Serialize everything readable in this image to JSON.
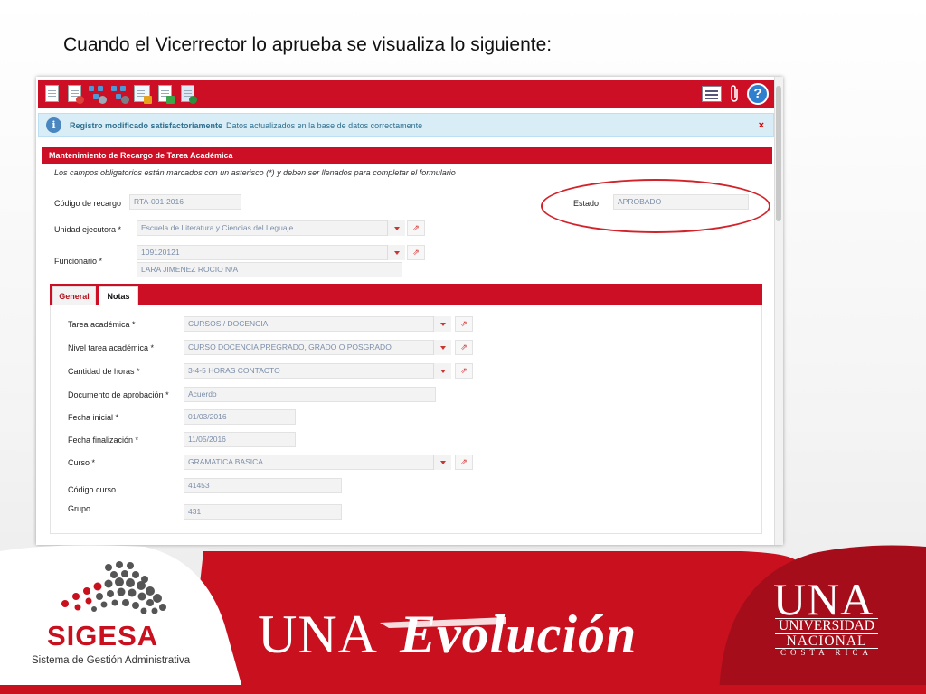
{
  "slide": {
    "title": "Cuando el Vicerrector lo aprueba se visualiza lo siguiente:"
  },
  "toolbar": {
    "left_icons": [
      "new-document-icon",
      "delete-document-icon",
      "workflow-search-icon",
      "workflow-settings-icon",
      "form-edit-icon",
      "document-return-icon",
      "user-add-icon"
    ],
    "right_icons": [
      "list-view-icon",
      "attachment-icon",
      "help-icon"
    ],
    "help_glyph": "?"
  },
  "alert": {
    "icon_glyph": "i",
    "title": "Registro modificado satisfactoriamente",
    "message": "Datos actualizados en la base de datos correctamente",
    "close_glyph": "×"
  },
  "form": {
    "panel_title": "Mantenimiento de Recargo de Tarea Académica",
    "required_note": "Los campos obligatorios están marcados con un asterisco (*) y deben ser llenados para completar el formulario",
    "codigo_recargo": {
      "label": "Código de recargo",
      "value": "RTA-001-2016"
    },
    "estado": {
      "label": "Estado",
      "value": "APROBADO"
    },
    "unidad_ejecutora": {
      "label": "Unidad ejecutora *",
      "value": "Escuela de Literatura y Ciencias del Leguaje"
    },
    "funcionario": {
      "label": "Funcionario *",
      "id_value": "109120121",
      "name_value": "LARA JIMENEZ ROCIO N/A"
    }
  },
  "tabs": [
    {
      "label": "General"
    },
    {
      "label": "Notas"
    }
  ],
  "tab_general": {
    "tarea_academica": {
      "label": "Tarea académica *",
      "value": "CURSOS / DOCENCIA"
    },
    "nivel_tarea": {
      "label": "Nivel tarea académica *",
      "value": "CURSO DOCENCIA PREGRADO, GRADO O POSGRADO"
    },
    "cantidad_horas": {
      "label": "Cantidad de horas *",
      "value": "3-4-5 HORAS CONTACTO"
    },
    "documento_aprobacion": {
      "label": "Documento de aprobación *",
      "value": "Acuerdo"
    },
    "fecha_inicial": {
      "label": "Fecha inicial *",
      "value": "01/03/2016"
    },
    "fecha_finalizacion": {
      "label": "Fecha finalización *",
      "value": "11/05/2016"
    },
    "curso": {
      "label": "Curso *",
      "value": "GRAMATICA BASICA"
    },
    "codigo_curso": {
      "label": "Código curso",
      "value": "41453"
    },
    "grupo": {
      "label": "Grupo",
      "value": "431"
    }
  },
  "link_glyph": "⇗",
  "branding": {
    "sigesa_name": "SIGESA",
    "sigesa_subtitle": "Sistema de Gestión Administrativa",
    "banner_una": "UNA",
    "banner_evolucion": "Evolución",
    "una_logo": "UNA",
    "una_line1": "UNIVERSIDAD",
    "una_line2": "NACIONAL",
    "una_line3": "COSTA RICA"
  },
  "colors": {
    "brand_red": "#cc0f24",
    "dark_red": "#b3151f",
    "highlight_ring": "#d2232a",
    "alert_bg": "#d9edf7",
    "alert_text": "#31708f"
  }
}
